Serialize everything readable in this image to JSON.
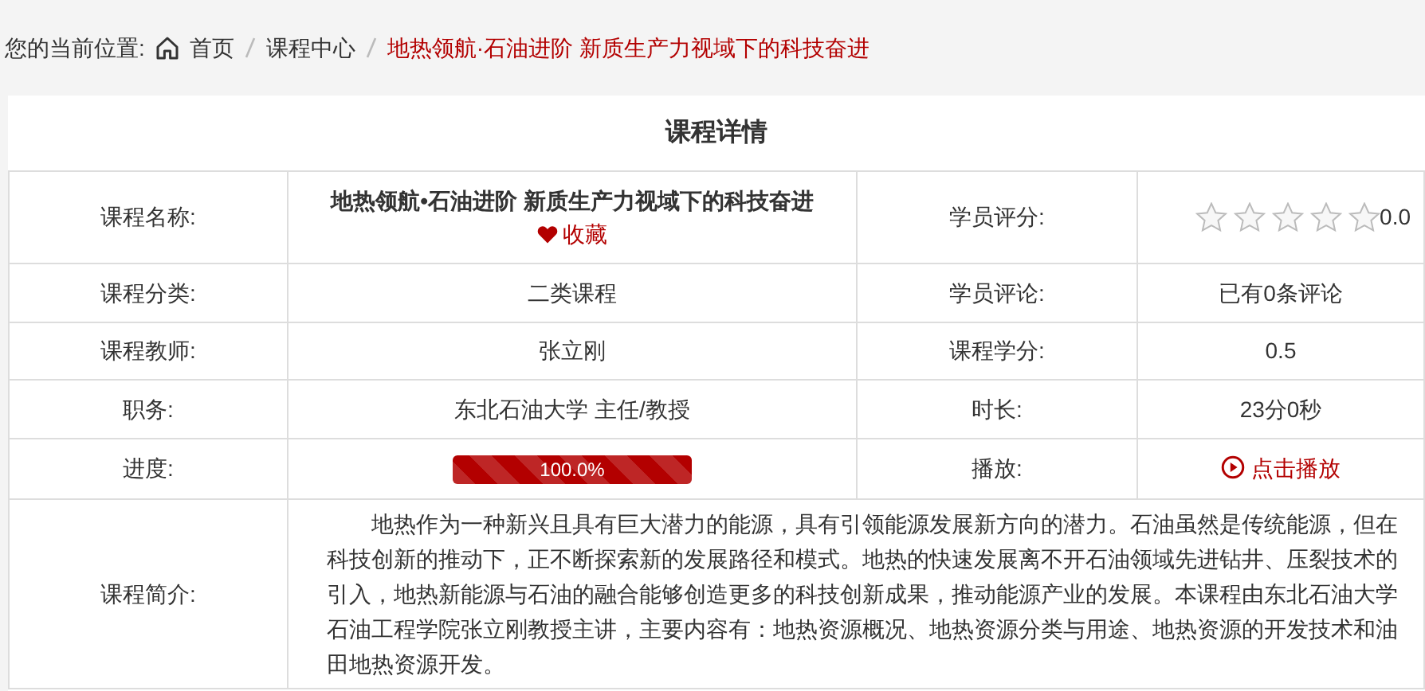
{
  "breadcrumb": {
    "label": "您的当前位置:",
    "items": [
      {
        "text": "首页",
        "current": false
      },
      {
        "text": "课程中心",
        "current": false
      },
      {
        "text": "地热领航·石油进阶 新质生产力视域下的科技奋进",
        "current": true
      }
    ]
  },
  "title": "课程详情",
  "rows": [
    [
      {
        "label": "课程名称:",
        "kind": "title",
        "value": "地热领航•石油进阶 新质生产力视域下的科技奋进",
        "favorite": "收藏"
      },
      {
        "label": "学员评分:",
        "kind": "rating",
        "stars": 0,
        "value": "0.0"
      }
    ],
    [
      {
        "label": "课程分类:",
        "kind": "text",
        "value": "二类课程"
      },
      {
        "label": "学员评论:",
        "kind": "text",
        "value": "已有0条评论"
      }
    ],
    [
      {
        "label": "课程教师:",
        "kind": "text",
        "value": "张立刚"
      },
      {
        "label": "课程学分:",
        "kind": "text",
        "value": "0.5"
      }
    ],
    [
      {
        "label": "职务:",
        "kind": "text",
        "value": "东北石油大学 主任/教授"
      },
      {
        "label": "时长:",
        "kind": "text",
        "value": "23分0秒"
      }
    ],
    [
      {
        "label": "进度:",
        "kind": "progress",
        "level": 1,
        "value": "100.0%"
      },
      {
        "label": "播放:",
        "kind": "link",
        "value": "点击播放"
      }
    ],
    [
      {
        "label": "课程简介:",
        "kind": "paragraph",
        "value": "地热作为一种新兴且具有巨大潜力的能源，具有引领能源发展新方向的潜力。石油虽然是传统能源，但在科技创新的推动下，正不断探索新的发展路径和模式。地热的快速发展离不开石油领域先进钻井、压裂技术的引入，地热新能源与石油的融合能够创造更多的科技创新成果，推动能源产业的发展。本课程由东北石油大学石油工程学院张立刚教授主讲，主要内容有：地热资源概况、地热资源分类与用途、地热资源的开发技术和油田地热资源开发。"
      }
    ]
  ]
}
